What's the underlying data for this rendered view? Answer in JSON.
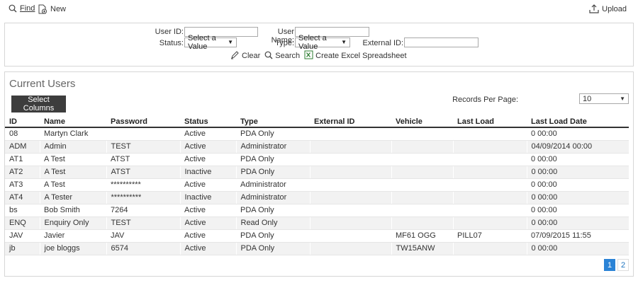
{
  "toolbar": {
    "find_label": "Find",
    "new_label": "New",
    "upload_label": "Upload"
  },
  "search": {
    "user_id_label": "User ID:",
    "user_id_value": "",
    "user_name_label": "User Name:",
    "user_name_value": "",
    "status_label": "Status:",
    "status_value": "Select a Value",
    "type_label": "Type:",
    "type_value": "Select a Value",
    "external_id_label": "External ID:",
    "external_id_value": "",
    "clear_label": "Clear",
    "search_label": "Search",
    "excel_label": "Create Excel Spreadsheet"
  },
  "users": {
    "title": "Current Users",
    "select_columns_label": "Select Columns",
    "records_per_page_label": "Records Per Page:",
    "records_per_page_value": "10",
    "columns": [
      "ID",
      "Name",
      "Password",
      "Status",
      "Type",
      "External ID",
      "Vehicle",
      "Last Load",
      "Last Load Date"
    ],
    "rows": [
      [
        "08",
        "Martyn Clark",
        "",
        "Active",
        "PDA Only",
        "",
        "",
        "",
        "0 00:00"
      ],
      [
        "ADM",
        "Admin",
        "TEST",
        "Active",
        "Administrator",
        "",
        "",
        "",
        "04/09/2014 00:00"
      ],
      [
        "AT1",
        "A Test",
        "ATST",
        "Active",
        "PDA Only",
        "",
        "",
        "",
        "0 00:00"
      ],
      [
        "AT2",
        "A Test",
        "ATST",
        "Inactive",
        "PDA Only",
        "",
        "",
        "",
        "0 00:00"
      ],
      [
        "AT3",
        "A Test",
        "**********",
        "Active",
        "Administrator",
        "",
        "",
        "",
        "0 00:00"
      ],
      [
        "AT4",
        "A Tester",
        "**********",
        "Inactive",
        "Administrator",
        "",
        "",
        "",
        "0 00:00"
      ],
      [
        "bs",
        "Bob Smith",
        "7264",
        "Active",
        "PDA Only",
        "",
        "",
        "",
        "0 00:00"
      ],
      [
        "ENQ",
        "Enquiry Only",
        "TEST",
        "Active",
        "Read Only",
        "",
        "",
        "",
        "0 00:00"
      ],
      [
        "JAV",
        "Javier",
        "JAV",
        "Active",
        "PDA Only",
        "",
        "MF61 OGG",
        "PILL07",
        "07/09/2015 11:55"
      ],
      [
        "jb",
        "joe bloggs",
        "6574",
        "Active",
        "PDA Only",
        "",
        "TW15ANW",
        "",
        "0 00:00"
      ]
    ],
    "pages": [
      "1",
      "2"
    ],
    "current_page": "1"
  },
  "colors": {
    "accent": "#2b83d6",
    "button_dark": "#3d3d3d",
    "row_alt": "#f2f2f2"
  },
  "icons": [
    "search-icon",
    "new-document-icon",
    "upload-icon",
    "pencil-icon",
    "excel-icon"
  ]
}
